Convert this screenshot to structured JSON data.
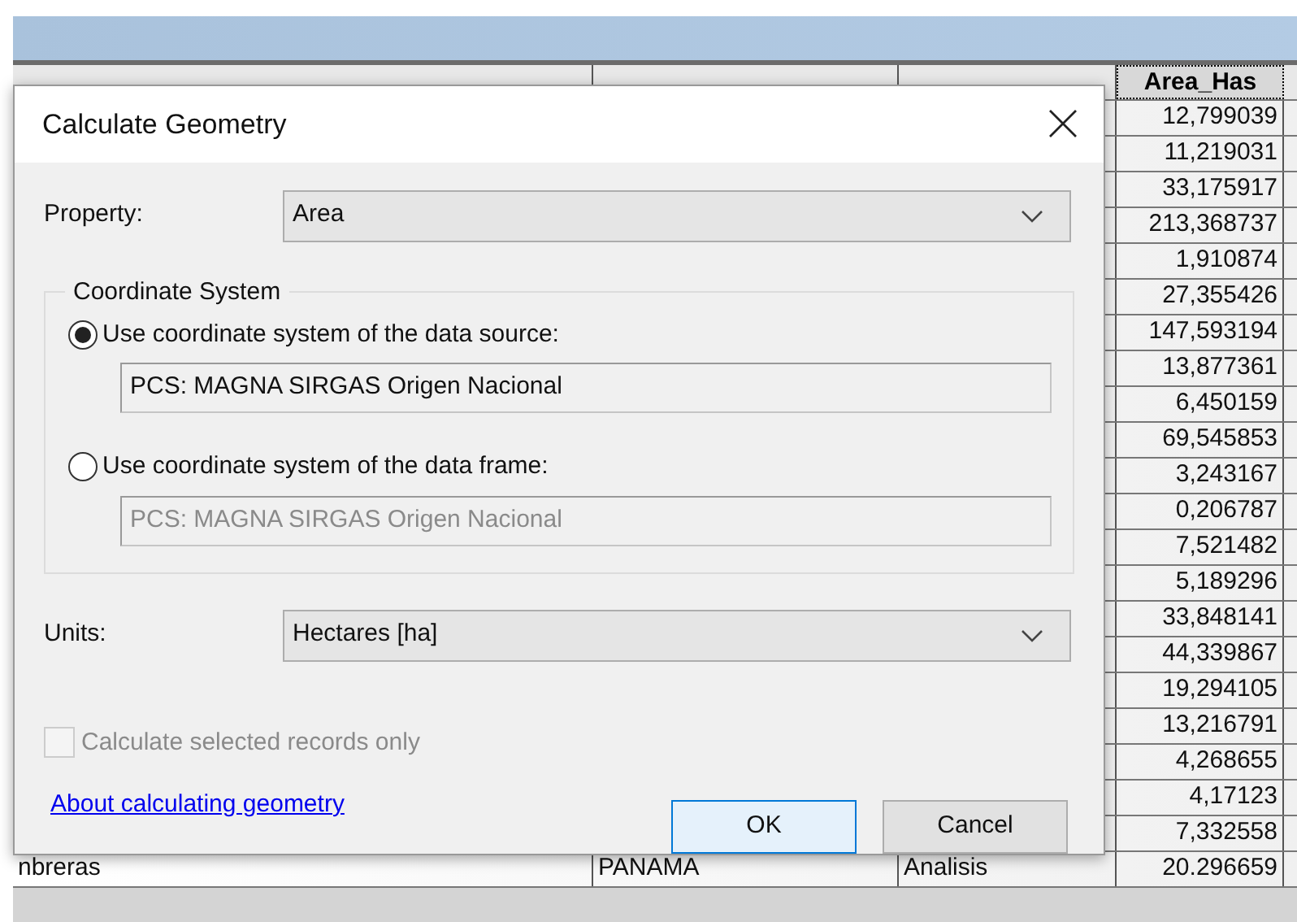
{
  "table": {
    "header": {
      "label": "Area_Has",
      "selected": true
    },
    "rows": [
      {
        "column_4": "12,799039"
      },
      {
        "column_4": "11,219031"
      },
      {
        "column_4": "33,175917"
      },
      {
        "column_4": "213,368737"
      },
      {
        "column_4": "1,910874"
      },
      {
        "column_4": "27,355426"
      },
      {
        "column_4": "147,593194"
      },
      {
        "column_4": "13,877361"
      },
      {
        "column_4": "6,450159"
      },
      {
        "column_4": "69,545853"
      },
      {
        "column_4": "3,243167"
      },
      {
        "column_4": "0,206787"
      },
      {
        "column_4": "7,521482"
      },
      {
        "column_4": "5,189296"
      },
      {
        "column_4": "33,848141"
      },
      {
        "column_4": "44,339867"
      },
      {
        "column_4": "19,294105"
      },
      {
        "column_4": "13,216791"
      },
      {
        "column_4": "4,268655"
      },
      {
        "column_4": "4,17123"
      },
      {
        "column_4": "7,332558"
      },
      {
        "column_1": "nbreras",
        "column_2": "PANAMA",
        "column_3": "Analisis",
        "column_4": "20.296659"
      }
    ]
  },
  "dialog": {
    "title": "Calculate Geometry",
    "property": {
      "label": "Property:",
      "value": "Area"
    },
    "coordinate_system": {
      "title": "Coordinate System",
      "options": [
        {
          "label": "Use coordinate system of the data source:",
          "selected": true,
          "field_value": "PCS: MAGNA SIRGAS Origen Nacional"
        },
        {
          "label": "Use coordinate system of the data frame:",
          "selected": false,
          "field_value": "PCS: MAGNA SIRGAS Origen Nacional"
        }
      ]
    },
    "units": {
      "label": "Units:",
      "value": "Hectares [ha]"
    },
    "selected_only": {
      "label": "Calculate selected records only",
      "checked": false,
      "disabled": true
    },
    "help_link": "About calculating geometry",
    "buttons": [
      {
        "label": "OK",
        "default": true
      },
      {
        "label": "Cancel",
        "default": false
      }
    ]
  }
}
